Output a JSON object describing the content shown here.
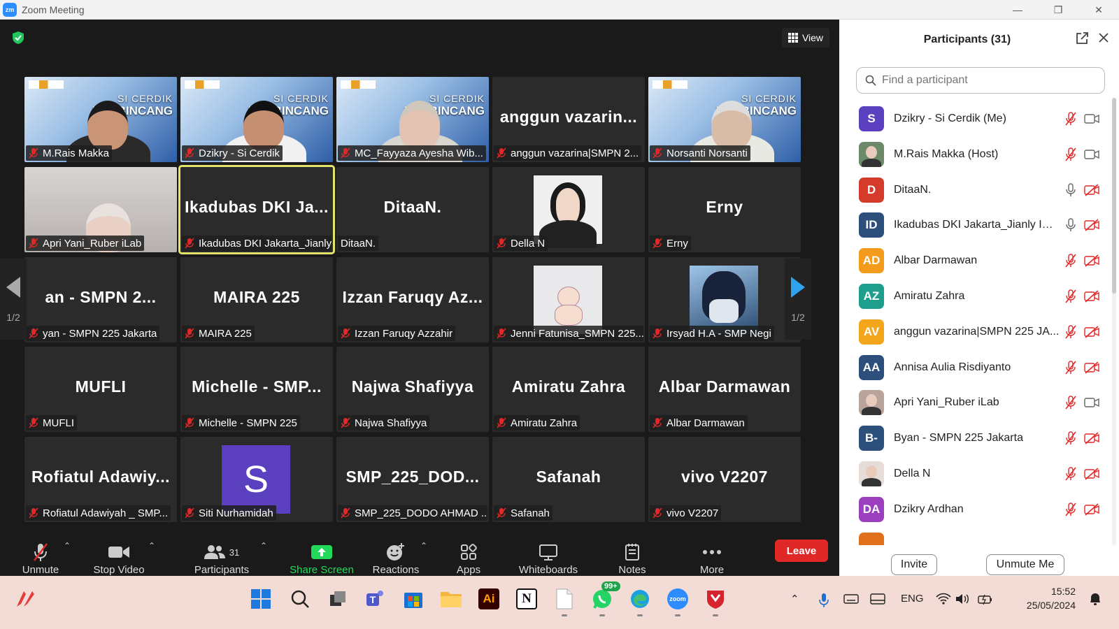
{
  "window": {
    "app_icon": "zm",
    "title": "Zoom Meeting"
  },
  "meeting": {
    "view_label": "View",
    "page_left": "1/2",
    "page_right": "1/2",
    "tiles": [
      {
        "big": "",
        "name": "M.Rais Makka",
        "kind": "video",
        "tag1": "SI CERDIK",
        "tag2": "BERBINCANG",
        "skin": "#c99576",
        "shirt": "#2a2a2a",
        "hair": "#1b1b1b"
      },
      {
        "big": "",
        "name": "Dzikry - Si Cerdik",
        "kind": "video",
        "tag1": "SI CERDIK",
        "tag2": "BERBINCANG",
        "skin": "#c59072",
        "shirt": "#f1f1f1",
        "hair": "#111"
      },
      {
        "big": "",
        "name": "MC_Fayyaza Ayesha Wib...",
        "kind": "video",
        "tag1": "SI CERDIK",
        "tag2": "BERBINCANG",
        "skin": "#e3c4b4",
        "shirt": "#d9d6cf",
        "hair": "#cfc8bb"
      },
      {
        "big": "anggun vazarin...",
        "name": "anggun vazarina|SMPN 2...",
        "kind": "text"
      },
      {
        "big": "",
        "name": "Norsanti Norsanti",
        "kind": "video",
        "tag1": "SI CERDIK",
        "tag2": "BERBINCANG",
        "skin": "#d8bca8",
        "shirt": "#e9e9e4",
        "hair": "#ddd"
      },
      {
        "big": "",
        "name": "Apri Yani_Ruber iLab",
        "kind": "cam"
      },
      {
        "big": "Ikadubas DKI Ja...",
        "name": "Ikadubas DKI Jakarta_Jianly I...",
        "kind": "text",
        "active": true
      },
      {
        "big": "DitaaN.",
        "name": "DitaaN.",
        "kind": "text",
        "nomic": true
      },
      {
        "big": "",
        "name": "Della N",
        "kind": "photo"
      },
      {
        "big": "Erny",
        "name": "Erny",
        "kind": "text"
      },
      {
        "big": "an - SMPN 2...",
        "name": "yan - SMPN 225 Jakarta",
        "kind": "text"
      },
      {
        "big": "MAIRA 225",
        "name": "MAIRA 225",
        "kind": "text"
      },
      {
        "big": "Izzan Faruqy Az...",
        "name": "Izzan Faruqy Azzahir",
        "kind": "text"
      },
      {
        "big": "",
        "name": "Jenni Fatunisa_SMPN 225...",
        "kind": "bear"
      },
      {
        "big": "",
        "name": "Irsyad H.A - SMP Negi",
        "kind": "anime"
      },
      {
        "big": "MUFLI",
        "name": "MUFLI",
        "kind": "text"
      },
      {
        "big": "Michelle - SMP...",
        "name": "Michelle - SMPN 225",
        "kind": "text"
      },
      {
        "big": "Najwa Shafiyya",
        "name": "Najwa Shafiyya",
        "kind": "text"
      },
      {
        "big": "Amiratu Zahra",
        "name": "Amiratu Zahra",
        "kind": "text"
      },
      {
        "big": "Albar Darmawan",
        "name": "Albar Darmawan",
        "kind": "text"
      },
      {
        "big": "Rofiatul Adawiy...",
        "name": "Rofiatul Adawiyah _ SMP...",
        "kind": "text"
      },
      {
        "big": "S",
        "name": "Siti Nurhamidah",
        "kind": "letter"
      },
      {
        "big": "SMP_225_DOD...",
        "name": "SMP_225_DODO AHMAD ...",
        "kind": "text"
      },
      {
        "big": "Safanah",
        "name": "Safanah",
        "kind": "text"
      },
      {
        "big": "vivo V2207",
        "name": "vivo V2207",
        "kind": "text"
      }
    ]
  },
  "toolbar": {
    "unmute": "Unmute",
    "stop_video": "Stop Video",
    "participants": "Participants",
    "participants_count": "31",
    "share_screen": "Share Screen",
    "reactions": "Reactions",
    "apps": "Apps",
    "whiteboards": "Whiteboards",
    "notes": "Notes",
    "more": "More",
    "leave": "Leave",
    "share_color": "#23d959",
    "leave_color": "#e02828"
  },
  "panel": {
    "title": "Participants (31)",
    "search_placeholder": "Find a participant",
    "invite": "Invite",
    "unmute_me": "Unmute Me",
    "participants": [
      {
        "initials": "S",
        "name": "Dzikry - Si Cerdik (Me)",
        "color": "#5a3fbf",
        "mic": "off",
        "cam": "on"
      },
      {
        "initials": "",
        "name": "M.Rais Makka (Host)",
        "color": "#6c8a6a",
        "photo": true,
        "mic": "off",
        "cam": "on"
      },
      {
        "initials": "D",
        "name": "DitaaN.",
        "color": "#d43b2a",
        "mic": "on",
        "cam": "off"
      },
      {
        "initials": "ID",
        "name": "Ikadubas DKI Jakarta_Jianly Ima...",
        "color": "#2d4f7c",
        "mic": "on",
        "cam": "off"
      },
      {
        "initials": "AD",
        "name": "Albar Darmawan",
        "color": "#f39b1c",
        "mic": "off",
        "cam": "off"
      },
      {
        "initials": "AZ",
        "name": "Amiratu Zahra",
        "color": "#1e9e8c",
        "mic": "off",
        "cam": "off"
      },
      {
        "initials": "AV",
        "name": "anggun vazarina|SMPN 225 JA...",
        "color": "#f3a51c",
        "mic": "off",
        "cam": "off"
      },
      {
        "initials": "AA",
        "name": "Annisa Aulia Risdiyanto",
        "color": "#2d4f7c",
        "mic": "off",
        "cam": "off"
      },
      {
        "initials": "",
        "name": "Apri Yani_Ruber iLab",
        "color": "#b8a49a",
        "photo": true,
        "mic": "off",
        "cam": "on"
      },
      {
        "initials": "B-",
        "name": "Byan - SMPN 225 Jakarta",
        "color": "#2d4f7c",
        "mic": "off",
        "cam": "off"
      },
      {
        "initials": "",
        "name": "Della N",
        "color": "#e6ddd8",
        "photo": true,
        "mic": "off",
        "cam": "off"
      },
      {
        "initials": "DA",
        "name": "Dzikry Ardhan",
        "color": "#9b3fbf",
        "mic": "off",
        "cam": "off"
      },
      {
        "initials": "",
        "name": "",
        "color": "#e0701c",
        "mic": "",
        "cam": ""
      }
    ]
  },
  "taskbar": {
    "lang": "ENG",
    "time": "15:52",
    "date": "25/05/2024",
    "whatsapp_badge": "99+",
    "zoom_label": "zoom",
    "adobe_label": "Ai",
    "notion_label": "N"
  }
}
